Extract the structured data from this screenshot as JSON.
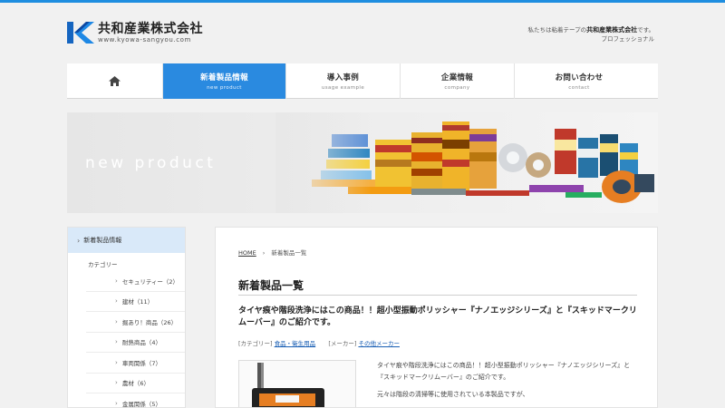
{
  "header": {
    "company_name": "共和産業株式会社",
    "url_text": "www.kyowa-sangyou.com",
    "tagline_prefix": "私たちは粘着テープの",
    "tagline_company": "共和産業株式会社",
    "tagline_suffix": "です。",
    "tagline_line2": "プロフェッショナル"
  },
  "nav": {
    "home_icon": "home-icon",
    "items": [
      {
        "label": "新着製品情報",
        "sub": "new product"
      },
      {
        "label": "導入事例",
        "sub": "usage example"
      },
      {
        "label": "企業情報",
        "sub": "company"
      },
      {
        "label": "お問い合わせ",
        "sub": "contact"
      }
    ]
  },
  "hero": {
    "title": "new product"
  },
  "sidebar": {
    "heading": "新着製品情報",
    "category_label": "カテゴリー",
    "items": [
      {
        "label": "セキュリティー（2）"
      },
      {
        "label": "建材（11）"
      },
      {
        "label": "掘あり！商品（26）"
      },
      {
        "label": "耐熱商品（4）"
      },
      {
        "label": "車両関係（7）"
      },
      {
        "label": "農材（6）"
      },
      {
        "label": "金属関係（5）"
      }
    ]
  },
  "main": {
    "breadcrumb_home": "HOME",
    "breadcrumb_sep": "›",
    "breadcrumb_current": "新着製品一覧",
    "page_title": "新着製品一覧",
    "post_title": "タイヤ痕や階段洗浄にはこの商品！！超小型振動ポリッシャー『ナノエッジシリーズ』と『スキッドマークリムーバー』のご紹介です。",
    "meta_category_label": "[カテゴリー]",
    "meta_category_value": "食品・衛生用品",
    "meta_maker_label": "[メーカー]",
    "meta_maker_value": "その他メーカー",
    "excerpt_1": "タイヤ痕や階段洗浄にはこの商品！！超小型振動ポリッシャー『ナノエッジシリーズ』と『スキッドマークリムーバー』のご紹介です。",
    "excerpt_2": "元々は階段の清掃等に使用されている本製品ですが、"
  },
  "colors": {
    "accent": "#2a8ae0",
    "topbar": "#1f8ee0",
    "sidebar_active": "#d9e9f9",
    "link": "#1a5fb4"
  }
}
